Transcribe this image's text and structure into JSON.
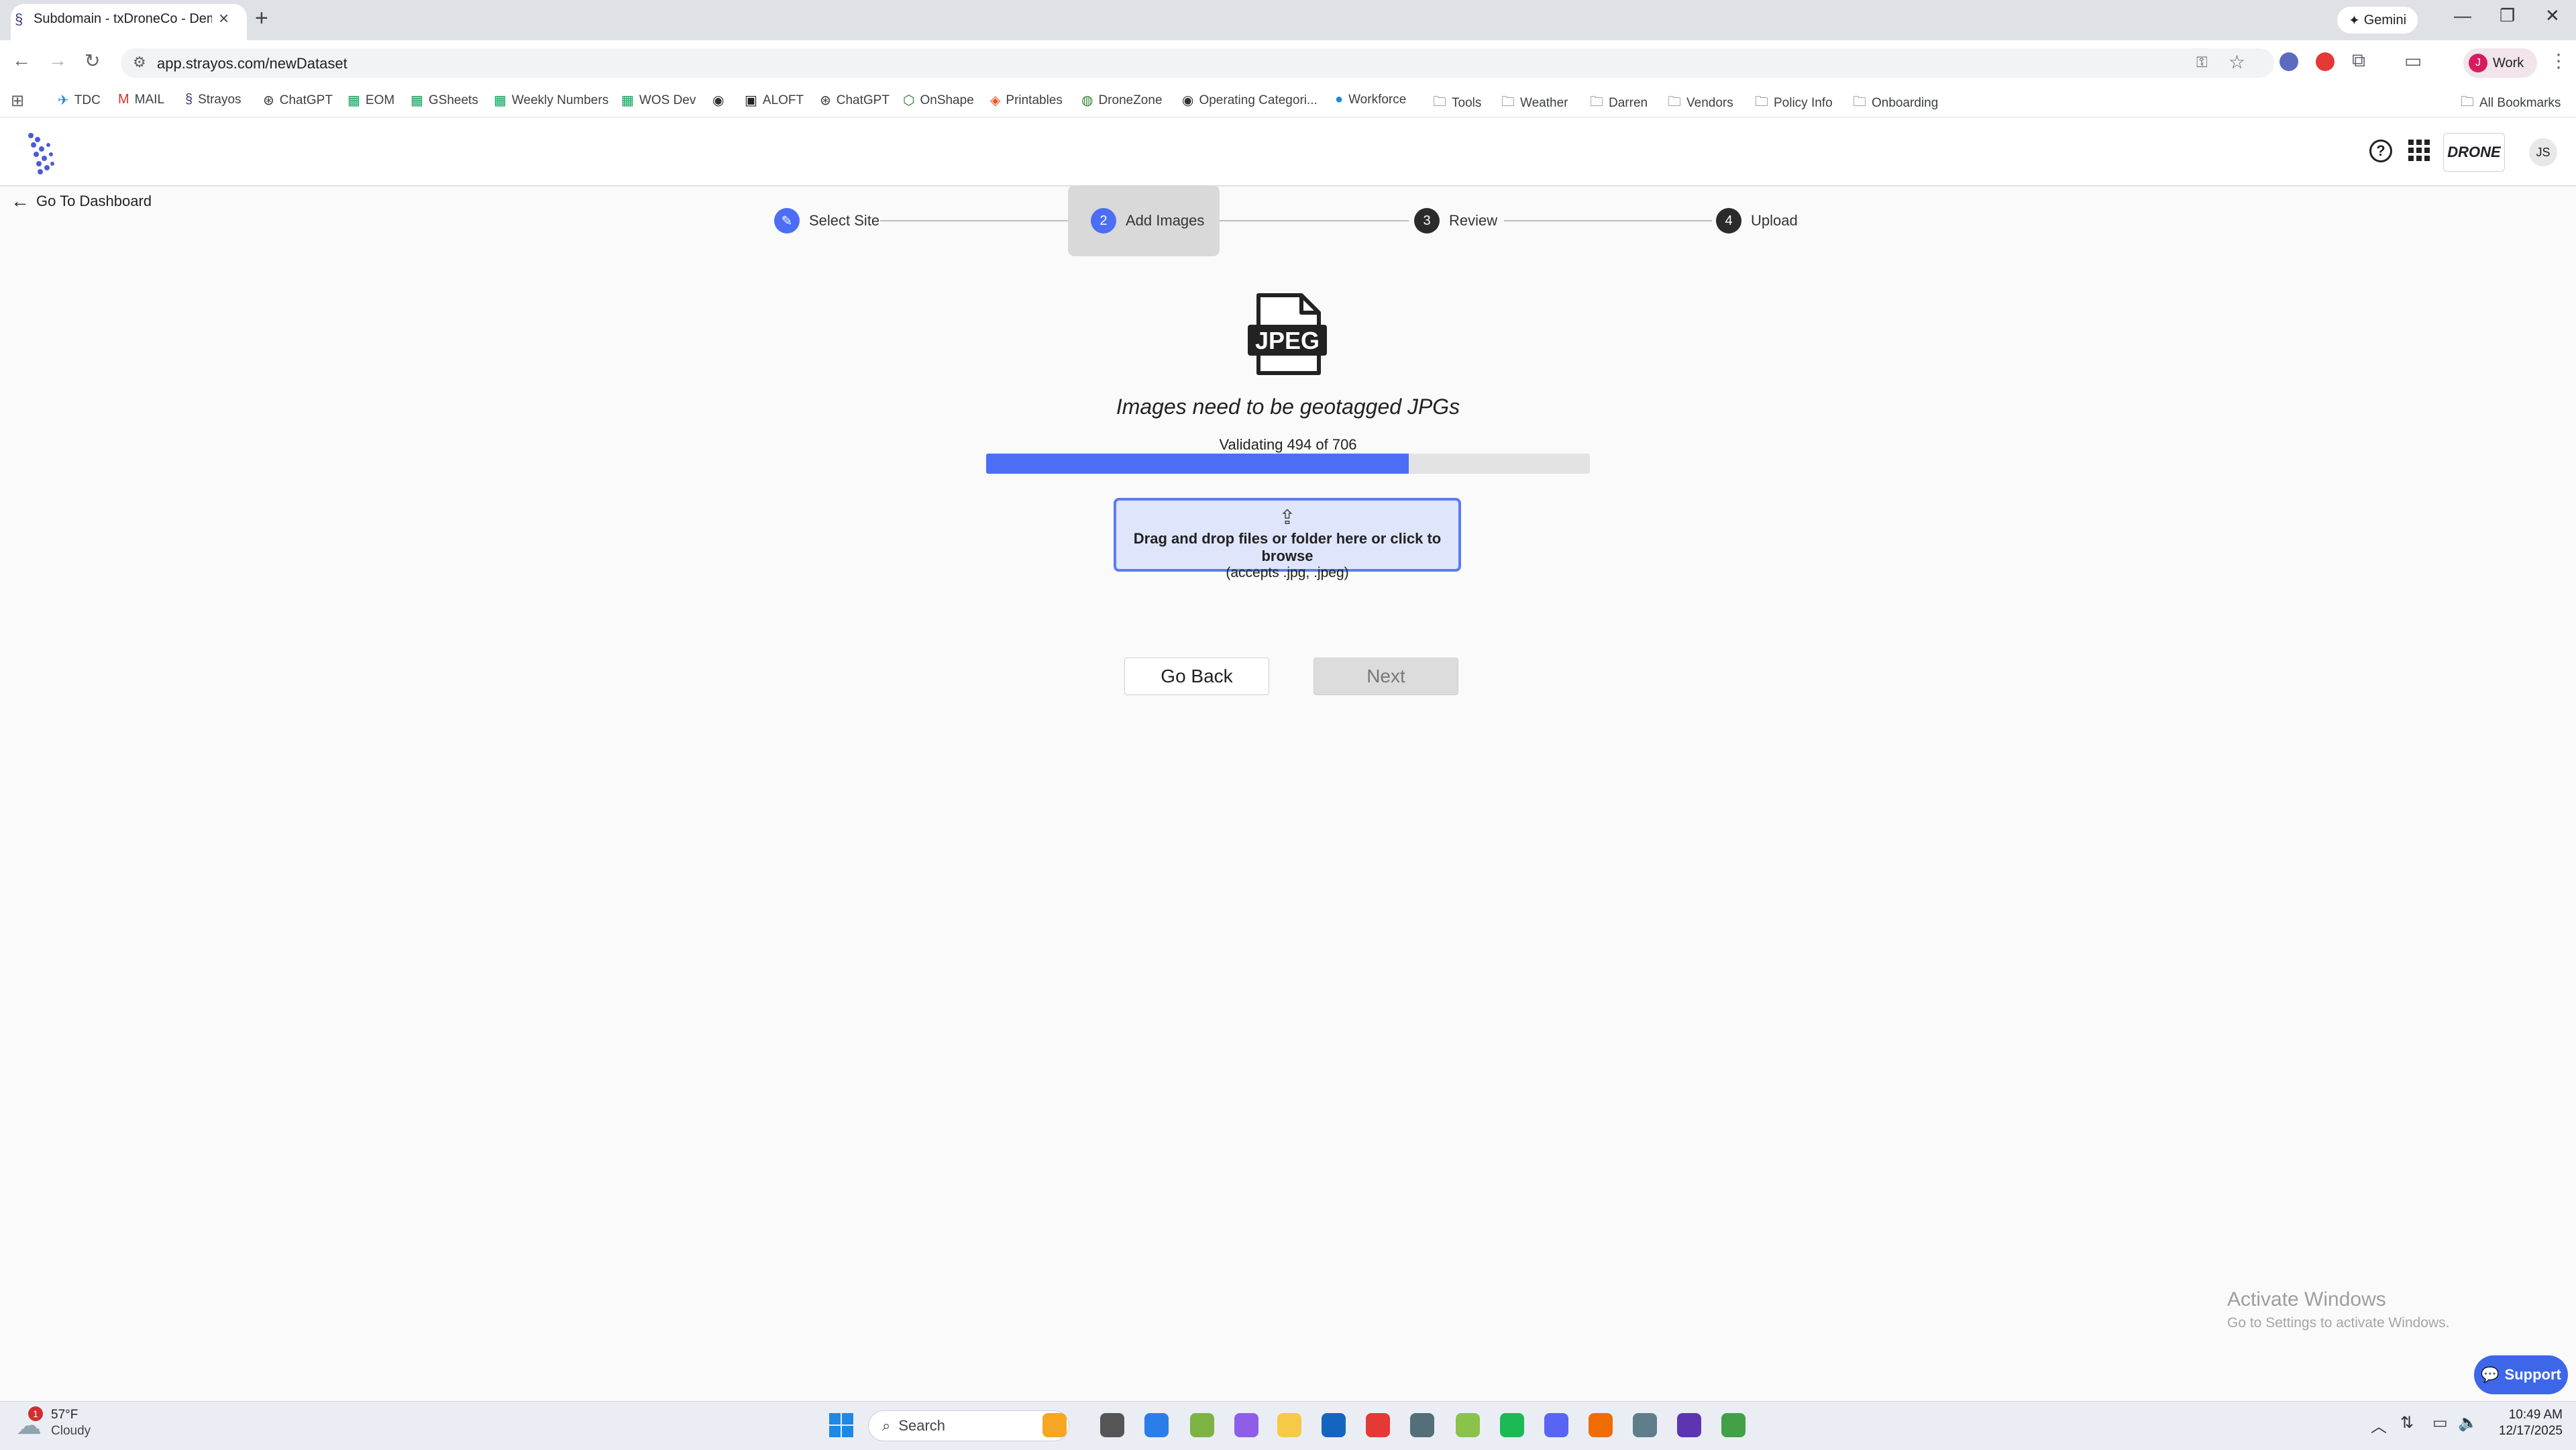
{
  "browser": {
    "tab_title": "Subdomain - txDroneCo - Dem",
    "new_tab_symbol": "+",
    "gemini_label": "Gemini",
    "url": "app.strayos.com/newDataset",
    "profile_label": "Work",
    "profile_initial": "J"
  },
  "bookmarks": [
    {
      "label": "TDC",
      "icon": "plane-icon"
    },
    {
      "label": "MAIL",
      "icon": "gmail-icon"
    },
    {
      "label": "Strayos",
      "icon": "strayos-icon"
    },
    {
      "label": "ChatGPT",
      "icon": "openai-icon"
    },
    {
      "label": "EOM",
      "icon": "sheets-icon"
    },
    {
      "label": "GSheets",
      "icon": "sheets-icon"
    },
    {
      "label": "Weekly Numbers",
      "icon": "sheets-icon"
    },
    {
      "label": "WOS Dev",
      "icon": "sheets-icon"
    },
    {
      "label": "",
      "icon": "globe-icon"
    },
    {
      "label": "ALOFT",
      "icon": "aloft-icon"
    },
    {
      "label": "ChatGPT",
      "icon": "openai-icon"
    },
    {
      "label": "OnShape",
      "icon": "onshape-icon"
    },
    {
      "label": "Printables",
      "icon": "printables-icon"
    },
    {
      "label": "DroneZone",
      "icon": "dronezone-icon"
    },
    {
      "label": "Operating Categori...",
      "icon": "globe-icon"
    },
    {
      "label": "Workforce",
      "icon": "workforce-icon"
    },
    {
      "label": "Tools",
      "icon": "folder-icon"
    },
    {
      "label": "Weather",
      "icon": "folder-icon"
    },
    {
      "label": "Darren",
      "icon": "folder-icon"
    },
    {
      "label": "Vendors",
      "icon": "folder-icon"
    },
    {
      "label": "Policy Info",
      "icon": "folder-icon"
    },
    {
      "label": "Onboarding",
      "icon": "folder-icon"
    }
  ],
  "all_bookmarks_label": "All Bookmarks",
  "header": {
    "help_symbol": "?",
    "org_logo_text": "DRONE",
    "user_initials": "JS"
  },
  "page": {
    "back_label": "Go To Dashboard",
    "steps": [
      {
        "number": "✎",
        "label": "Select Site",
        "state": "done"
      },
      {
        "number": "2",
        "label": "Add Images",
        "state": "active"
      },
      {
        "number": "3",
        "label": "Review",
        "state": "pending"
      },
      {
        "number": "4",
        "label": "Upload",
        "state": "pending"
      }
    ],
    "jpeg_icon_text": "JPEG",
    "instructions": "Images need to be geotagged JPGs",
    "progress": {
      "label": "Validating 494 of 706",
      "current": 494,
      "total": 706
    },
    "dropzone": {
      "title": "Drag and drop files or folder here or click to browse",
      "subtitle": "(accepts .jpg, .jpeg)"
    },
    "go_back_label": "Go Back",
    "next_label": "Next",
    "support_label": "Support"
  },
  "watermark": {
    "title": "Activate Windows",
    "subtitle": "Go to Settings to activate Windows."
  },
  "taskbar": {
    "weather_temp": "57°F",
    "weather_condition": "Cloudy",
    "weather_badge": "1",
    "search_placeholder": "Search",
    "time": "10:49 AM",
    "date": "12/17/2025"
  },
  "colors": {
    "accent": "#4c6ef5",
    "support": "#3d67e8"
  }
}
